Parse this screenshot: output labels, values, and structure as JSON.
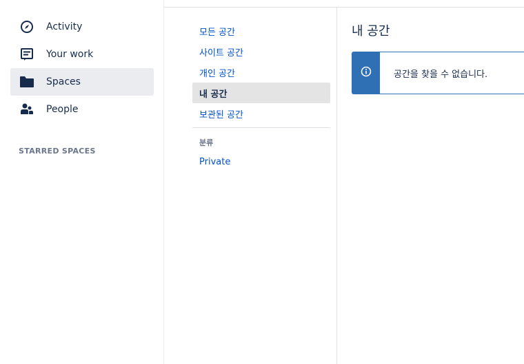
{
  "sidebar": {
    "items": [
      {
        "label": "Activity",
        "icon": "compass-icon"
      },
      {
        "label": "Your work",
        "icon": "document-icon"
      },
      {
        "label": "Spaces",
        "icon": "folder-icon",
        "active": true
      },
      {
        "label": "People",
        "icon": "people-icon"
      }
    ],
    "starred_heading": "STARRED SPACES"
  },
  "filters": {
    "items": [
      {
        "label": "모든 공간"
      },
      {
        "label": "사이트 공간"
      },
      {
        "label": "개인 공간"
      },
      {
        "label": "내 공간",
        "active": true
      },
      {
        "label": "보관된 공간"
      }
    ],
    "category_heading": "분류",
    "categories": [
      {
        "label": "Private"
      }
    ]
  },
  "main": {
    "title": "내 공간",
    "info_message": "공간을 찾을 수 없습니다."
  },
  "colors": {
    "link": "#0052cc",
    "active_bg": "#ebecf0",
    "info_blue": "#2f6fb3",
    "text": "#172b4d"
  }
}
